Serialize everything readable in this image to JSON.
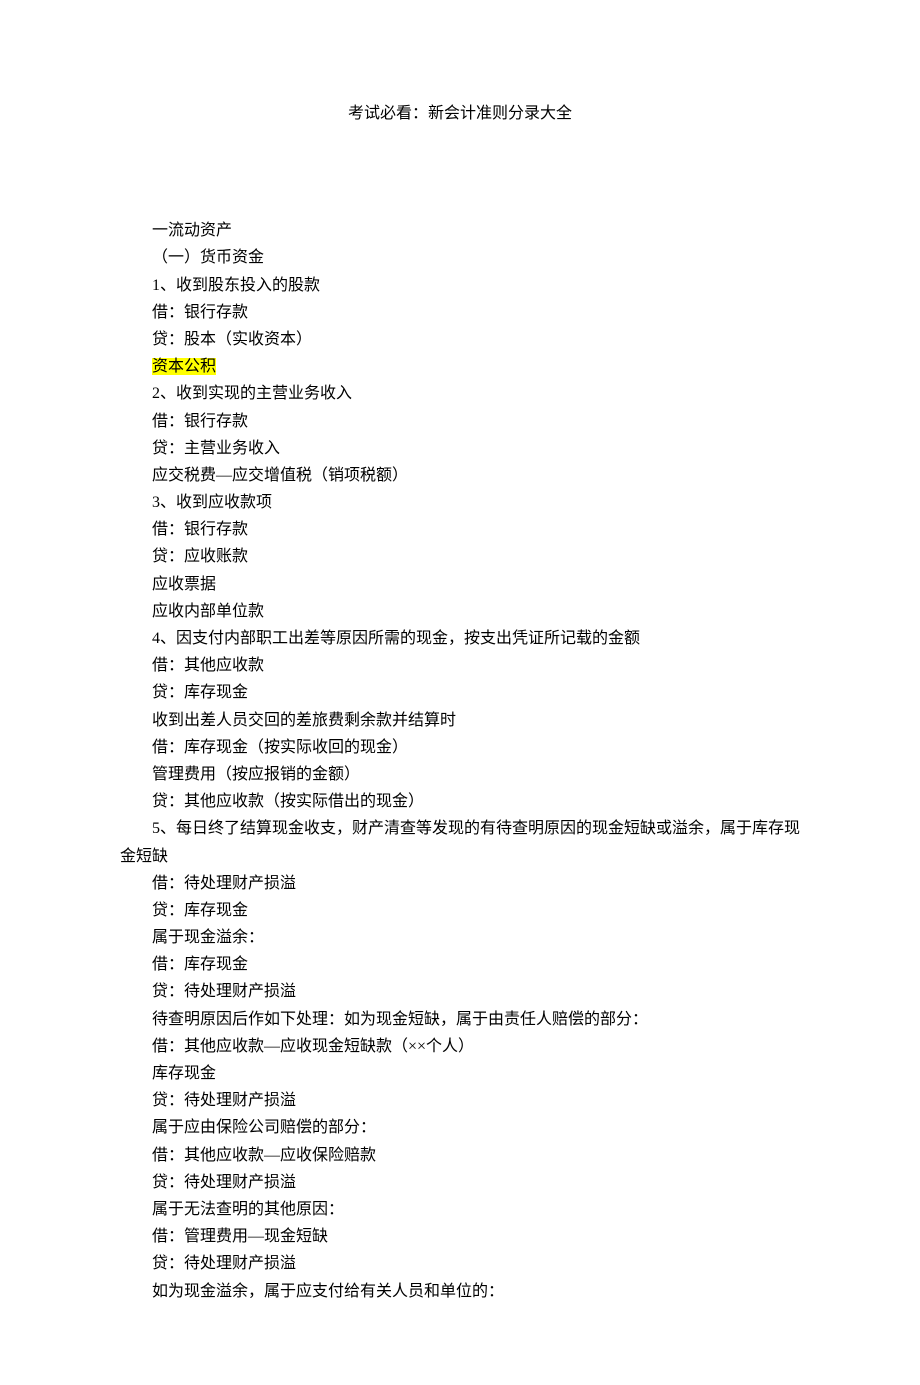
{
  "title": "考试必看：新会计准则分录大全",
  "lines": [
    {
      "text": "一流动资产",
      "indent": true
    },
    {
      "text": "（一）货币资金",
      "indent": true
    },
    {
      "text": "1、收到股东投入的股款",
      "indent": true
    },
    {
      "text": "借：银行存款",
      "indent": true
    },
    {
      "text": "贷：股本（实收资本）",
      "indent": true
    },
    {
      "text": "资本公积",
      "indent": true,
      "highlight": true
    },
    {
      "text": "2、收到实现的主营业务收入",
      "indent": true
    },
    {
      "text": "借：银行存款",
      "indent": true
    },
    {
      "text": "贷：主营业务收入",
      "indent": true
    },
    {
      "text": "应交税费—应交增值税（销项税额）",
      "indent": true
    },
    {
      "text": "3、收到应收款项",
      "indent": true
    },
    {
      "text": "借：银行存款",
      "indent": true
    },
    {
      "text": "贷：应收账款",
      "indent": true
    },
    {
      "text": "应收票据",
      "indent": true
    },
    {
      "text": "应收内部单位款",
      "indent": true
    },
    {
      "text": "4、因支付内部职工出差等原因所需的现金，按支出凭证所记载的金额",
      "indent": true
    },
    {
      "text": "借：其他应收款",
      "indent": true
    },
    {
      "text": "贷：库存现金",
      "indent": true
    },
    {
      "text": "收到出差人员交回的差旅费剩余款并结算时",
      "indent": true
    },
    {
      "text": "借：库存现金（按实际收回的现金）",
      "indent": true
    },
    {
      "text": "管理费用（按应报销的金额）",
      "indent": true
    },
    {
      "text": "贷：其他应收款（按实际借出的现金）",
      "indent": true
    },
    {
      "text": "5、每日终了结算现金收支，财产清查等发现的有待查明原因的现金短缺或溢余，属于库存现金短缺",
      "indent": true,
      "wrap": true
    },
    {
      "text": "借：待处理财产损溢",
      "indent": true
    },
    {
      "text": "贷：库存现金",
      "indent": true
    },
    {
      "text": "属于现金溢余：",
      "indent": true
    },
    {
      "text": "借：库存现金",
      "indent": true
    },
    {
      "text": "贷：待处理财产损溢",
      "indent": true
    },
    {
      "text": "待查明原因后作如下处理：如为现金短缺，属于由责任人赔偿的部分：",
      "indent": true
    },
    {
      "text": "借：其他应收款—应收现金短缺款（××个人）",
      "indent": true
    },
    {
      "text": "库存现金",
      "indent": true
    },
    {
      "text": "贷：待处理财产损溢",
      "indent": true
    },
    {
      "text": "属于应由保险公司赔偿的部分：",
      "indent": true
    },
    {
      "text": "借：其他应收款—应收保险赔款",
      "indent": true
    },
    {
      "text": "贷：待处理财产损溢",
      "indent": true
    },
    {
      "text": "属于无法查明的其他原因：",
      "indent": true
    },
    {
      "text": "借：管理费用—现金短缺",
      "indent": true
    },
    {
      "text": "贷：待处理财产损溢",
      "indent": true
    },
    {
      "text": "如为现金溢余，属于应支付给有关人员和单位的：",
      "indent": true
    }
  ]
}
